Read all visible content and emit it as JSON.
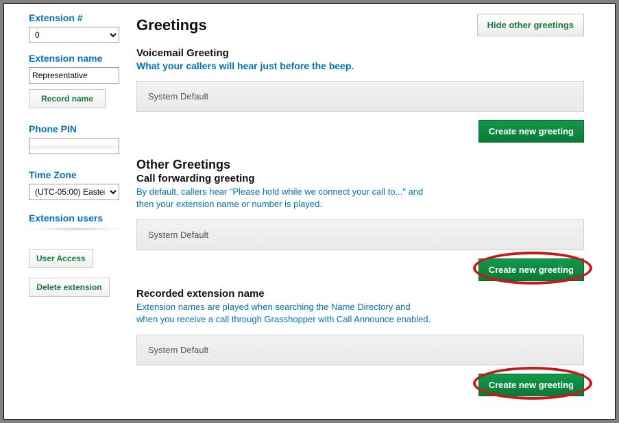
{
  "sidebar": {
    "extension_num_label": "Extension #",
    "extension_num_value": "0",
    "extension_name_label": "Extension name",
    "extension_name_value": "Representative",
    "record_name_btn": "Record name",
    "phone_pin_label": "Phone PIN",
    "phone_pin_value": "",
    "timezone_label": "Time Zone",
    "timezone_value": "(UTC-05:00) Easter",
    "extension_users_label": "Extension users",
    "user_access_btn": "User Access",
    "delete_extension_btn": "Delete extension"
  },
  "main": {
    "title": "Greetings",
    "hide_btn": "Hide other greetings",
    "voicemail": {
      "heading": "Voicemail Greeting",
      "subtitle": "What your callers will hear just before the beep.",
      "box_text": "System Default",
      "create_btn": "Create new greeting"
    },
    "other": {
      "heading": "Other Greetings",
      "call_fwd_heading": "Call forwarding greeting",
      "call_fwd_desc": "By default, callers hear \"Please hold while we connect your call to...\" and then your extension name or number is played.",
      "box_text": "System Default",
      "create_btn": "Create new greeting"
    },
    "recorded": {
      "heading": "Recorded extension name",
      "desc": "Extension names are played when searching the Name Directory and when you receive a call through Grasshopper with Call Announce enabled.",
      "box_text": "System Default",
      "create_btn": "Create new greeting"
    }
  }
}
